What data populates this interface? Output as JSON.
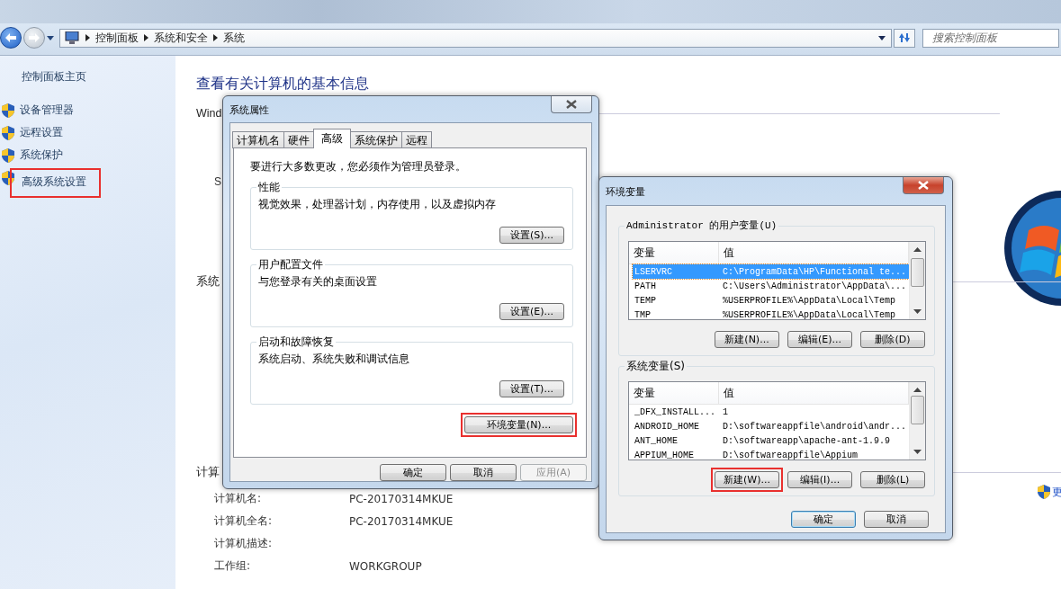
{
  "address_bar": {
    "breadcrumbs": [
      "控制面板",
      "系统和安全",
      "系统"
    ],
    "search_placeholder": "搜索控制面板"
  },
  "sidebar": {
    "home": "控制面板主页",
    "items": [
      {
        "label": "设备管理器",
        "highlighted": false
      },
      {
        "label": "远程设置",
        "highlighted": false
      },
      {
        "label": "系统保护",
        "highlighted": false
      },
      {
        "label": "高级系统设置",
        "highlighted": true
      }
    ]
  },
  "main": {
    "title": "查看有关计算机的基本信息",
    "sections": [
      {
        "heading": "Wind",
        "items": [
          "S"
        ]
      },
      {
        "heading": "系统"
      },
      {
        "heading": "计算",
        "rows": [
          {
            "label": "计算机名:",
            "value": "PC-20170314MKUE"
          },
          {
            "label": "计算机全名:",
            "value": "PC-20170314MKUE"
          },
          {
            "label": "计算机描述:"
          },
          {
            "label": "工作组:",
            "value": "WORKGROUP"
          }
        ],
        "link": "更"
      }
    ]
  },
  "system_properties": {
    "title": "系统属性",
    "tabs": [
      {
        "label": "计算机名",
        "selected": false
      },
      {
        "label": "硬件",
        "selected": false
      },
      {
        "label": "高级",
        "selected": true
      },
      {
        "label": "系统保护",
        "selected": false
      },
      {
        "label": "远程",
        "selected": false
      }
    ],
    "notice": "要进行大多数更改，您必须作为管理员登录。",
    "groups": [
      {
        "title": "性能",
        "description": "视觉效果，处理器计划，内存使用，以及虚拟内存",
        "button": "设置(S)..."
      },
      {
        "title": "用户配置文件",
        "description": "与您登录有关的桌面设置",
        "button": "设置(E)..."
      },
      {
        "title": "启动和故障恢复",
        "description": "系统启动、系统失败和调试信息",
        "button": "设置(T)..."
      }
    ],
    "env_button": {
      "label": "环境变量(N)...",
      "highlighted": true
    },
    "buttons": [
      {
        "label": "确定",
        "disabled": false
      },
      {
        "label": "取消",
        "disabled": false
      },
      {
        "label": "应用(A)",
        "disabled": true
      }
    ]
  },
  "environment_variables": {
    "title": "环境变量",
    "groups": [
      {
        "title": "Administrator 的用户变量(U)",
        "columns": [
          "变量",
          "值"
        ],
        "rows": [
          {
            "name": "LSERVRC",
            "value": "C:\\ProgramData\\HP\\Functional te...",
            "selected": true
          },
          {
            "name": "PATH",
            "value": "C:\\Users\\Administrator\\AppData\\...",
            "selected": false
          },
          {
            "name": "TEMP",
            "value": "%USERPROFILE%\\AppData\\Local\\Temp",
            "selected": false
          },
          {
            "name": "TMP",
            "value": "%USERPROFILE%\\AppData\\Local\\Temp",
            "selected": false
          }
        ],
        "buttons": [
          {
            "label": "新建(N)...",
            "highlighted": false
          },
          {
            "label": "编辑(E)...",
            "highlighted": false
          },
          {
            "label": "删除(D)",
            "highlighted": false
          }
        ]
      },
      {
        "title": "系统变量(S)",
        "columns": [
          "变量",
          "值"
        ],
        "rows": [
          {
            "name": "_DFX_INSTALL...",
            "value": "1",
            "selected": false
          },
          {
            "name": "ANDROID_HOME",
            "value": "D:\\softwareappfile\\android\\andr...",
            "selected": false
          },
          {
            "name": "ANT_HOME",
            "value": "D:\\softwareapp\\apache-ant-1.9.9",
            "selected": false
          },
          {
            "name": "APPIUM_HOME",
            "value": "D:\\softwareappfile\\Appium",
            "selected": false
          }
        ],
        "buttons": [
          {
            "label": "新建(W)...",
            "highlighted": true
          },
          {
            "label": "编辑(I)...",
            "highlighted": false
          },
          {
            "label": "删除(L)",
            "highlighted": false
          }
        ]
      }
    ],
    "buttons": [
      {
        "label": "确定",
        "default": true
      },
      {
        "label": "取消",
        "default": false
      }
    ]
  }
}
